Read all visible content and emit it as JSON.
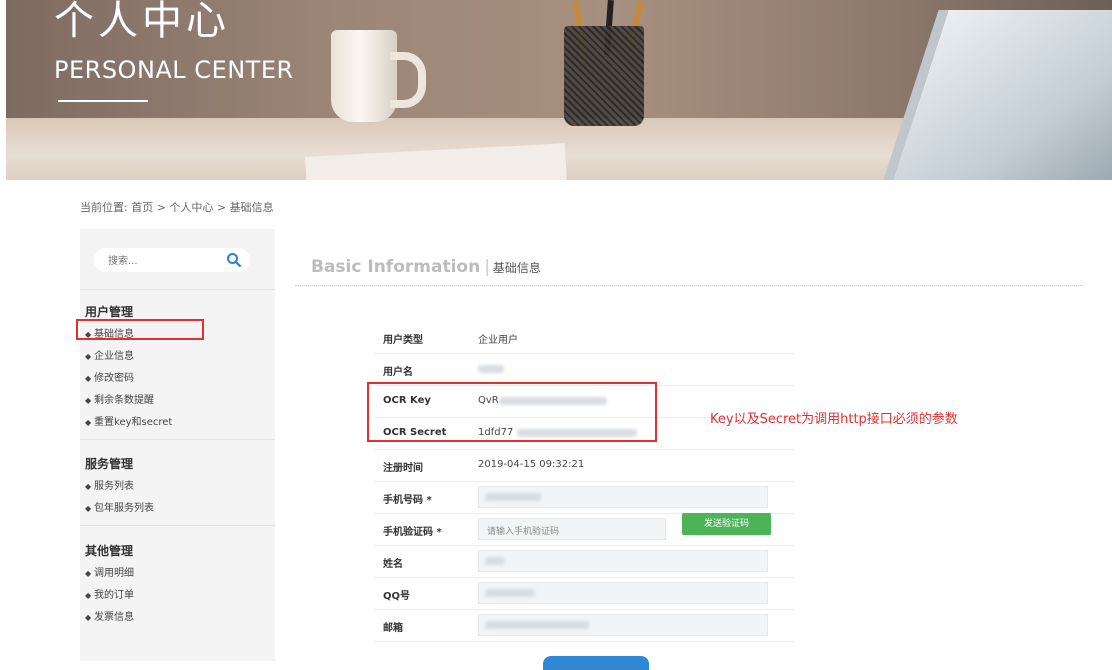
{
  "banner": {
    "title_cn": "个人中心",
    "title_en": "PERSONAL CENTER"
  },
  "breadcrumb": "当前位置: 首页 > 个人中心 > 基础信息",
  "search": {
    "placeholder": "搜索..."
  },
  "sidebar": {
    "groups": [
      {
        "title": "用户管理",
        "items": [
          "基础信息",
          "企业信息",
          "修改密码",
          "剩余条数提醒",
          "重置key和secret"
        ]
      },
      {
        "title": "服务管理",
        "items": [
          "服务列表",
          "包年服务列表"
        ]
      },
      {
        "title": "其他管理",
        "items": [
          "调用明细",
          "我的订单",
          "发票信息"
        ]
      }
    ],
    "bullet": "◆"
  },
  "main": {
    "title_en": "Basic Information",
    "title_sep": "|",
    "title_cn": "基础信息",
    "rows": {
      "user_type": {
        "label": "用户类型",
        "value": "企业用户"
      },
      "username": {
        "label": "用户名"
      },
      "ocr_key": {
        "label": "OCR Key",
        "value": "QvR"
      },
      "ocr_secret": {
        "label": "OCR Secret",
        "value": "1dfd77"
      },
      "reg_time": {
        "label": "注册时间",
        "value": "2019-04-15 09:32:21"
      },
      "phone": {
        "label": "手机号码 *"
      },
      "sms_code": {
        "label": "手机验证码 *",
        "placeholder": "请输入手机验证码"
      },
      "name": {
        "label": "姓名"
      },
      "qq": {
        "label": "QQ号"
      },
      "email": {
        "label": "邮箱"
      }
    },
    "send_code_label": "发送验证码",
    "annotation": "Key以及Secret为调用http接口必须的参数"
  },
  "colors": {
    "accent_red": "#e0302f",
    "send_green": "#4cb457",
    "save_blue": "#2f89d6"
  }
}
